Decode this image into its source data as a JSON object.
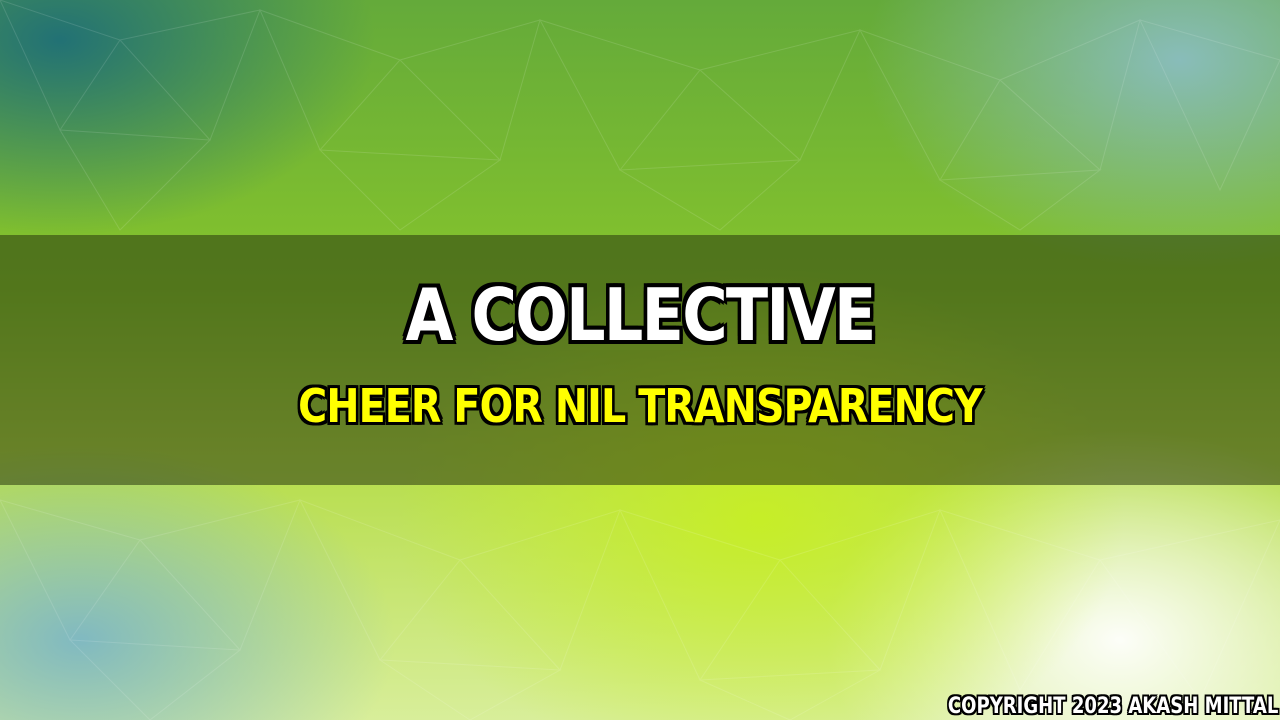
{
  "banner": {
    "title": "A COLLECTIVE",
    "subtitle": "CHEER FOR NIL TRANSPARENCY"
  },
  "footer": {
    "copyright": "COPYRIGHT 2023 AKASH MITTAL"
  },
  "colors": {
    "title": "#ffffff",
    "subtitle": "#ffff00",
    "outline": "#000000",
    "band": "#28370f"
  }
}
